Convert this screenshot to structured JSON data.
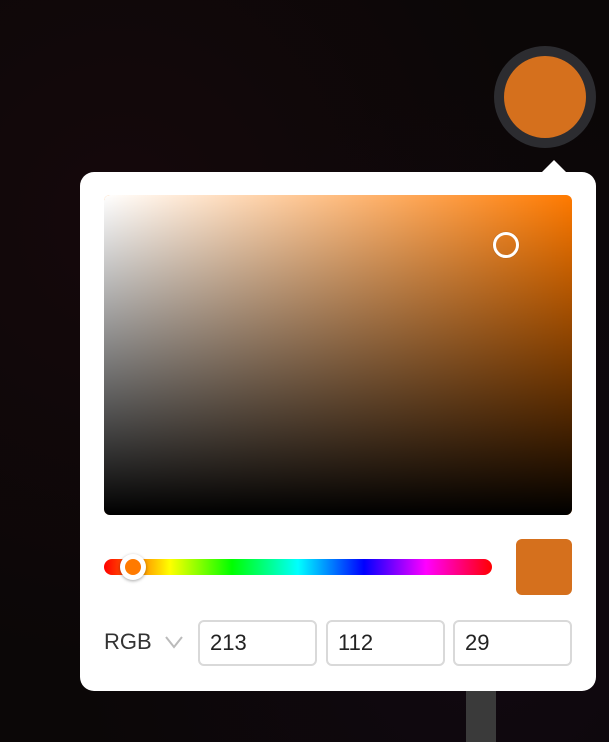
{
  "color": {
    "hex": "#d5701d",
    "hue_hex": "#ff7a00",
    "hue_fraction": 0.073
  },
  "format": {
    "selected": "RGB"
  },
  "channels": [
    {
      "name": "R",
      "value": "213"
    },
    {
      "name": "G",
      "value": "112"
    },
    {
      "name": "B",
      "value": "29"
    }
  ],
  "icons": {
    "format_toggle": "chevron-down-icon"
  }
}
